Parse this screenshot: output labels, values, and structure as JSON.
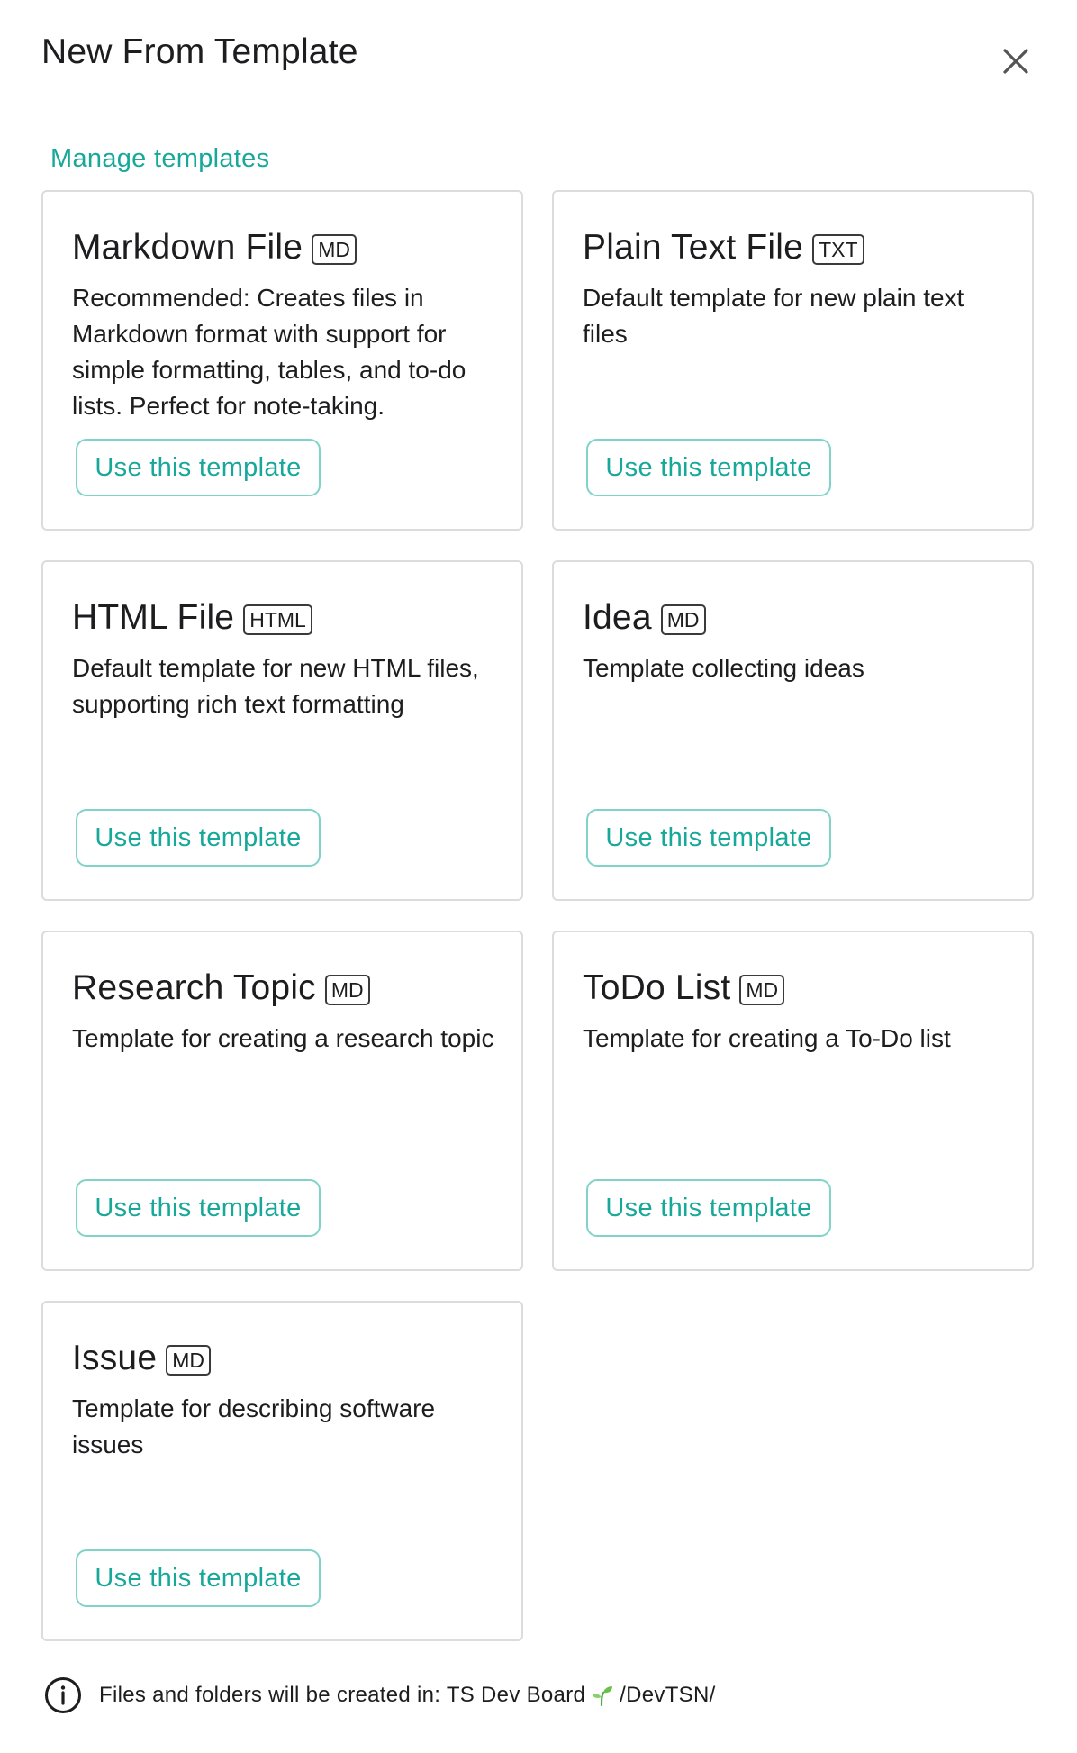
{
  "dialog": {
    "title": "New From Template",
    "close_icon": "close-icon"
  },
  "manage_link": "Manage templates",
  "templates": [
    {
      "title": "Markdown File",
      "badge": "MD",
      "description": "Recommended: Creates files in Markdown format with support for simple formatting, tables, and to-do lists. Perfect for note-taking.",
      "button": "Use this template"
    },
    {
      "title": "Plain Text File",
      "badge": "TXT",
      "description": "Default template for new plain text files",
      "button": "Use this template"
    },
    {
      "title": "HTML File",
      "badge": "HTML",
      "description": "Default template for new HTML files, supporting rich text formatting",
      "button": "Use this template"
    },
    {
      "title": "Idea",
      "badge": "MD",
      "description": "Template collecting ideas",
      "button": "Use this template"
    },
    {
      "title": "Research Topic",
      "badge": "MD",
      "description": "Template for creating a research topic",
      "button": "Use this template"
    },
    {
      "title": "ToDo List",
      "badge": "MD",
      "description": "Template for creating a To-Do list",
      "button": "Use this template"
    },
    {
      "title": "Issue",
      "badge": "MD",
      "description": "Template for describing software issues",
      "button": "Use this template"
    }
  ],
  "footer": {
    "prefix": "Files and folders will be created in: TS Dev Board",
    "path": "/DevTSN/",
    "icon": "info-icon",
    "location_icon": "sprout-icon"
  },
  "colors": {
    "accent": "#17a89a",
    "button_border": "#7fd3c9",
    "card_border": "#dcdcdc",
    "text": "#1d1d1f"
  }
}
